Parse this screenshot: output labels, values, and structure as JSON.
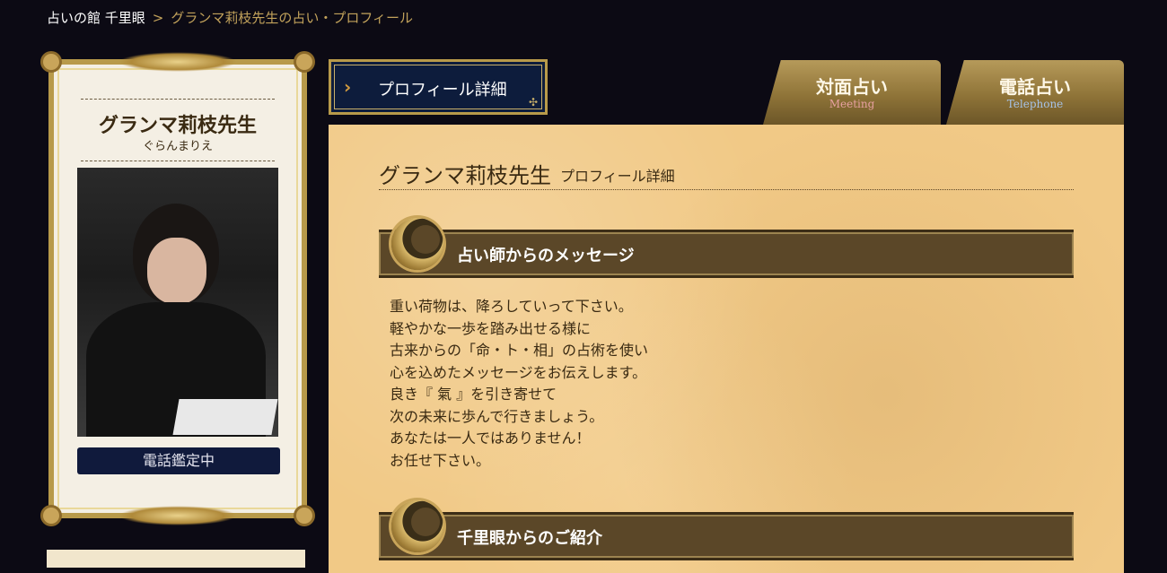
{
  "breadcrumb": {
    "home": "占いの館 千里眼",
    "sep": ">",
    "current": "グランマ莉枝先生の占い・プロフィール"
  },
  "profile_card": {
    "name": "グランマ莉枝先生",
    "kana": "ぐらんまりえ",
    "photo_alt": "グランマ莉枝先生",
    "status": "電話鑑定中"
  },
  "section_tab": {
    "label": "プロフィール詳細"
  },
  "tabs": [
    {
      "jp": "対面占い",
      "en": "Meeting"
    },
    {
      "jp": "電話占い",
      "en": "Telephone"
    }
  ],
  "main": {
    "title": "グランマ莉枝先生",
    "subtitle": "プロフィール詳細",
    "sections": [
      {
        "heading": "占い師からのメッセージ",
        "lines": [
          "重い荷物は、降ろしていって下さい。",
          "軽やかな一歩を踏み出せる様に",
          "古来からの「命・ト・相」の占術を使い",
          "心を込めたメッセージをお伝えします。",
          "良き『 氣 』を引き寄せて",
          "次の未来に歩んで行きましょう。",
          "あなたは一人ではありません！",
          "お任せ下さい。"
        ]
      },
      {
        "heading": "千里眼からのご紹介"
      }
    ]
  }
}
